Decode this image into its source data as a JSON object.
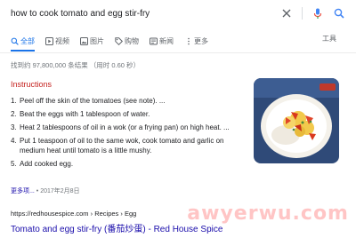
{
  "search": {
    "query": "how to cook tomato and egg stir-fry"
  },
  "tabs": [
    {
      "label": "全部",
      "icon": "search-icon"
    },
    {
      "label": "视频",
      "icon": "video-icon"
    },
    {
      "label": "图片",
      "icon": "image-icon"
    },
    {
      "label": "购物",
      "icon": "tag-icon"
    },
    {
      "label": "新闻",
      "icon": "news-icon"
    },
    {
      "label": "更多",
      "icon": "more-dots-icon"
    }
  ],
  "tools_label": "工具",
  "result_stats": "找到约 97,800,000 条结果 （用时 0.60 秒）",
  "snippet": {
    "title": "Instructions",
    "steps": [
      {
        "num": "1.",
        "text": "Peel off the skin of the tomatoes (see note). ..."
      },
      {
        "num": "2.",
        "text": "Beat the eggs with 1 tablespoon of water."
      },
      {
        "num": "3.",
        "text": "Heat 2 tablespoons of oil in a wok (or a frying pan) on high heat. ..."
      },
      {
        "num": "4.",
        "text": "Put 1 teaspoon of oil to the same wok, cook tomato and garlic on medium heat until tomato is a little mushy."
      },
      {
        "num": "5.",
        "text": "Add cooked egg."
      }
    ],
    "more_label": "更多项...",
    "date": "• 2017年2月8日"
  },
  "source": {
    "url": "https://redhousespice.com › Recipes › Egg",
    "title": "Tomato and egg stir-fry (番茄炒蛋) - Red House Spice"
  },
  "watermark": "awyerwu.com",
  "colors": {
    "accent": "#1a73e8",
    "link": "#1a0dab",
    "snippet_title": "#c5221f"
  }
}
